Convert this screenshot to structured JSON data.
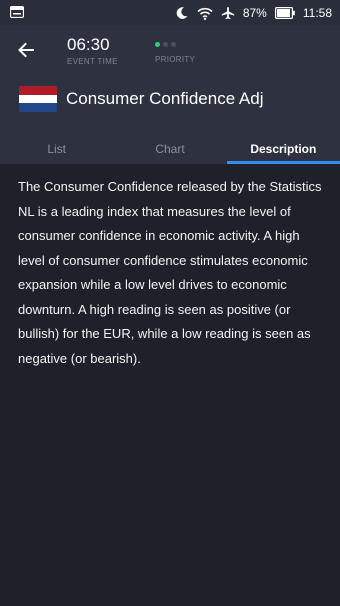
{
  "status_bar": {
    "battery": "87%",
    "clock": "11:58"
  },
  "header": {
    "event_time": "06:30",
    "event_time_label": "EVENT TIME",
    "priority_label": "PRIORITY",
    "priority_level": 1,
    "priority_max": 3,
    "title": "Consumer Confidence Adj"
  },
  "tabs": [
    {
      "label": "List",
      "active": false
    },
    {
      "label": "Chart",
      "active": false
    },
    {
      "label": "Description",
      "active": true
    }
  ],
  "description": "The Consumer Confidence released by the Statistics NL is a leading index that measures the level of consumer confidence in economic activity. A high level of consumer confidence stimulates economic expansion while a low level drives to economic downturn. A high reading is seen as positive (or bullish) for the EUR, while a low reading is seen as negative (or bearish).",
  "colors": {
    "accent": "#2f8ff0",
    "priority_on": "#2fd07a",
    "priority_off": "#4a4f5c"
  }
}
